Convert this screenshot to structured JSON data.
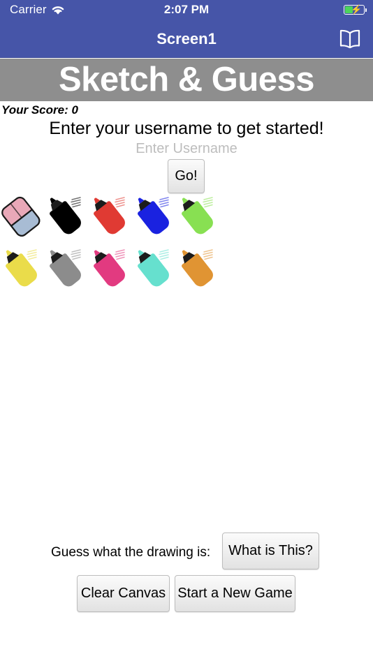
{
  "status_bar": {
    "carrier": "Carrier",
    "wifi_icon": "wifi-icon",
    "time": "2:07 PM",
    "battery_icon": "battery-charging-icon"
  },
  "nav_bar": {
    "title": "Screen1",
    "right_icon": "open-book-icon"
  },
  "banner": {
    "title": "Sketch & Guess",
    "background_color": "#8e8e8e",
    "text_color": "#ffffff"
  },
  "score": {
    "label": "Your Score: 0"
  },
  "onboarding": {
    "prompt": "Enter your username to get started!",
    "username_value": "",
    "username_placeholder": "Enter Username",
    "go_label": "Go!"
  },
  "tools": [
    {
      "name": "eraser",
      "label": "Eraser",
      "color": "#e9a8b8",
      "accent": "#a8bcd4"
    },
    {
      "name": "marker-black",
      "label": "Black Marker",
      "color": "#000000"
    },
    {
      "name": "marker-red",
      "label": "Red Marker",
      "color": "#e03a33"
    },
    {
      "name": "marker-blue",
      "label": "Blue Marker",
      "color": "#1a22e0"
    },
    {
      "name": "marker-green",
      "label": "Green Marker",
      "color": "#88e052"
    },
    {
      "name": "marker-yellow",
      "label": "Yellow Marker",
      "color": "#eadc4a"
    },
    {
      "name": "marker-gray",
      "label": "Gray Marker",
      "color": "#8c8c8c"
    },
    {
      "name": "marker-pink",
      "label": "Pink Marker",
      "color": "#e23a80"
    },
    {
      "name": "marker-turquoise",
      "label": "Turquoise Marker",
      "color": "#66e0ce"
    },
    {
      "name": "marker-orange",
      "label": "Orange Marker",
      "color": "#e09433"
    }
  ],
  "footer": {
    "guess_label": "Guess what the drawing is:",
    "what_is_this_label": "What is This?",
    "clear_canvas_label": "Clear Canvas",
    "new_game_label": "Start a New Game"
  },
  "theme": {
    "nav_color": "#4655a8",
    "banner_color": "#8e8e8e",
    "battery_green": "#4cd55b"
  }
}
